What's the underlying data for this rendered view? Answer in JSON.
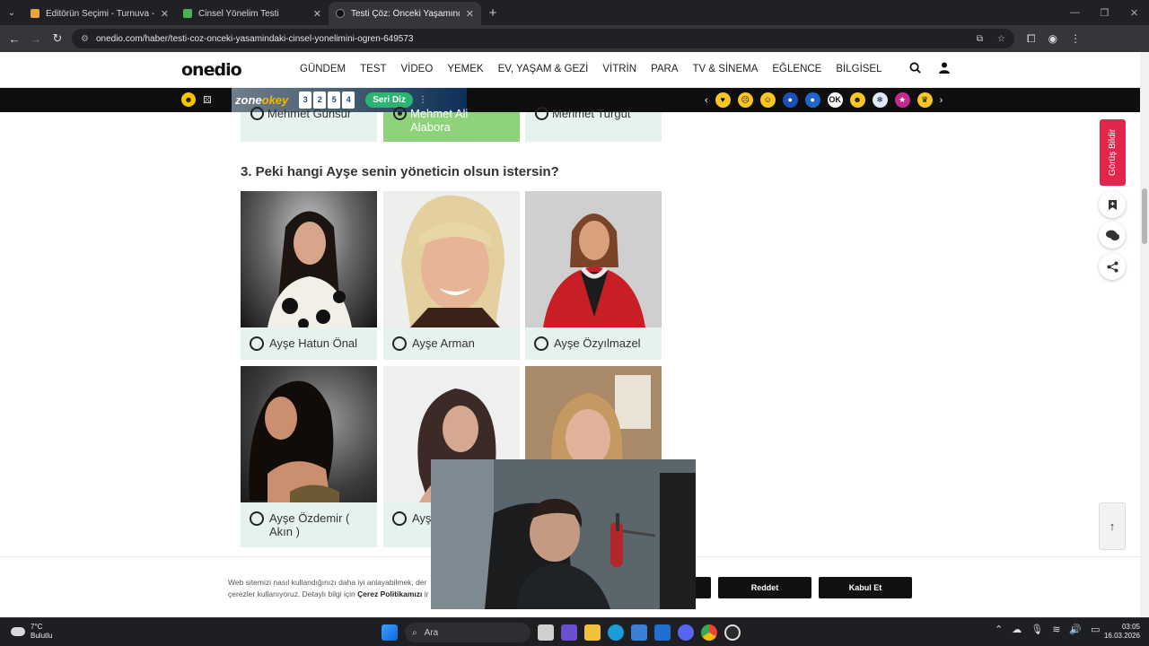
{
  "browser": {
    "tabs": [
      {
        "title": "Editörün Seçimi - Turnuva - Qu",
        "favicon_color": "#e8a33a"
      },
      {
        "title": "Cinsel Yönelim Testi",
        "favicon_color": "#4caf50"
      },
      {
        "title": "Testi Çöz: Önceki Yaşamındaki C",
        "favicon_color": "#111111"
      }
    ],
    "active_tab": 2,
    "url": "onedio.com/haber/testi-coz-onceki-yasamindaki-cinsel-yonelimini-ogren-649573"
  },
  "site": {
    "logo": "onedio",
    "menu": [
      "GÜNDEM",
      "TEST",
      "VİDEO",
      "YEMEK",
      "EV, YAŞAM & GEZİ",
      "VİTRİN",
      "PARA",
      "TV & SİNEMA",
      "EĞLENCE",
      "BİLGİSEL"
    ]
  },
  "ad": {
    "brand_a": "zone",
    "brand_b": "okey",
    "tiles": [
      "3",
      "2",
      "5",
      "4"
    ],
    "cta": "Seri Diz"
  },
  "previous_question_options": [
    {
      "label": "Mehmet Günsür",
      "selected": false
    },
    {
      "label": "Mehmet Ali Alabora",
      "selected": true
    },
    {
      "label": "Mehmet Turgut",
      "selected": false
    }
  ],
  "question": {
    "title": "3. Peki hangi Ayşe senin yöneticin olsun istersin?",
    "options": [
      {
        "label": "Ayşe Hatun Önal"
      },
      {
        "label": "Ayşe Arman"
      },
      {
        "label": "Ayşe Özyılmazel"
      },
      {
        "label": "Ayşe Özdemir ( Akın )"
      },
      {
        "label": "Ayş"
      },
      {
        "label": ""
      }
    ]
  },
  "side": {
    "feedback": "Görüş Bildir"
  },
  "cookie": {
    "text_a": "Web sitemizi nasıl kullandığınızı daha iyi anlayabilmek, der",
    "text_b": "çerezler kullanıyoruz. Detaylı bilgi için ",
    "policy": "Çerez Politikamızı",
    "text_c": " ir",
    "reject": "Reddet",
    "accept": "Kabul Et"
  },
  "taskbar": {
    "temp": "7°C",
    "weather": "Bulutlu",
    "search": "Ara",
    "time": "03:05",
    "date": "16.03.2026"
  }
}
